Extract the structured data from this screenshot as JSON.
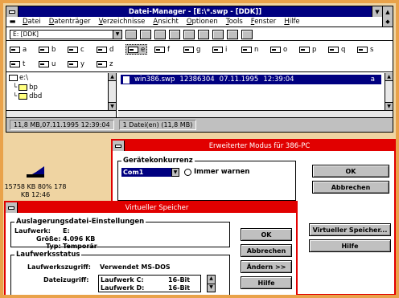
{
  "file_manager": {
    "title": "Datei-Manager - [E:\\*.swp - [DDK]]",
    "menu": [
      "Datei",
      "Datenträger",
      "Verzeichnisse",
      "Ansicht",
      "Optionen",
      "Tools",
      "Fenster",
      "Hilfe"
    ],
    "drive_select": "E: [DDK]",
    "drives": [
      "a",
      "b",
      "c",
      "d",
      "e",
      "f",
      "g",
      "i",
      "n",
      "o",
      "p",
      "q",
      "s",
      "t",
      "u",
      "y",
      "z"
    ],
    "selected_drive": "e",
    "tree": [
      {
        "label": "e:\\",
        "open": true
      },
      {
        "label": "bp",
        "open": false
      },
      {
        "label": "dbd",
        "open": false
      }
    ],
    "selected_file": {
      "name": "win386.swp",
      "size": "12386304",
      "date": "07.11.1995",
      "time": "12:39:04",
      "attr": "a"
    },
    "status_left": "11,8 MB,07.11.1995 12:39:04",
    "status_right": "1 Datei(en) (11,8 MB)"
  },
  "desktop_icon": {
    "label_line1": "15758 KB 80% 178",
    "label_line2": "KB 12:46"
  },
  "dialog_386": {
    "title": "Erweiterter Modus für 386-PC",
    "group_label": "Gerätekonkurrenz",
    "port_value": "Com1",
    "radio_label": "Immer warnen",
    "buttons": [
      "OK",
      "Abbrechen",
      "Virtueller Speicher...",
      "Hilfe"
    ]
  },
  "dialog_vm": {
    "title": "Virtueller Speicher",
    "group_swap": "Auslagerungsdatei-Einstellungen",
    "drive_label": "Laufwerk:",
    "drive_value": "E:",
    "size_label": "Größe:",
    "size_value": "4.096 KB",
    "type_label": "Typ:",
    "type_value": "Temporär",
    "group_status": "Laufwerksstatus",
    "drive_access_label": "Laufwerkszugriff:",
    "drive_access_value": "Verwendet MS-DOS",
    "file_access_label": "Dateizugriff:",
    "file_access_rows": [
      {
        "drive": "Laufwerk C:",
        "mode": "16-Bit"
      },
      {
        "drive": "Laufwerk D:",
        "mode": "16-Bit"
      }
    ],
    "buttons": [
      "OK",
      "Abbrechen",
      "Ändern >>",
      "Hilfe"
    ]
  }
}
